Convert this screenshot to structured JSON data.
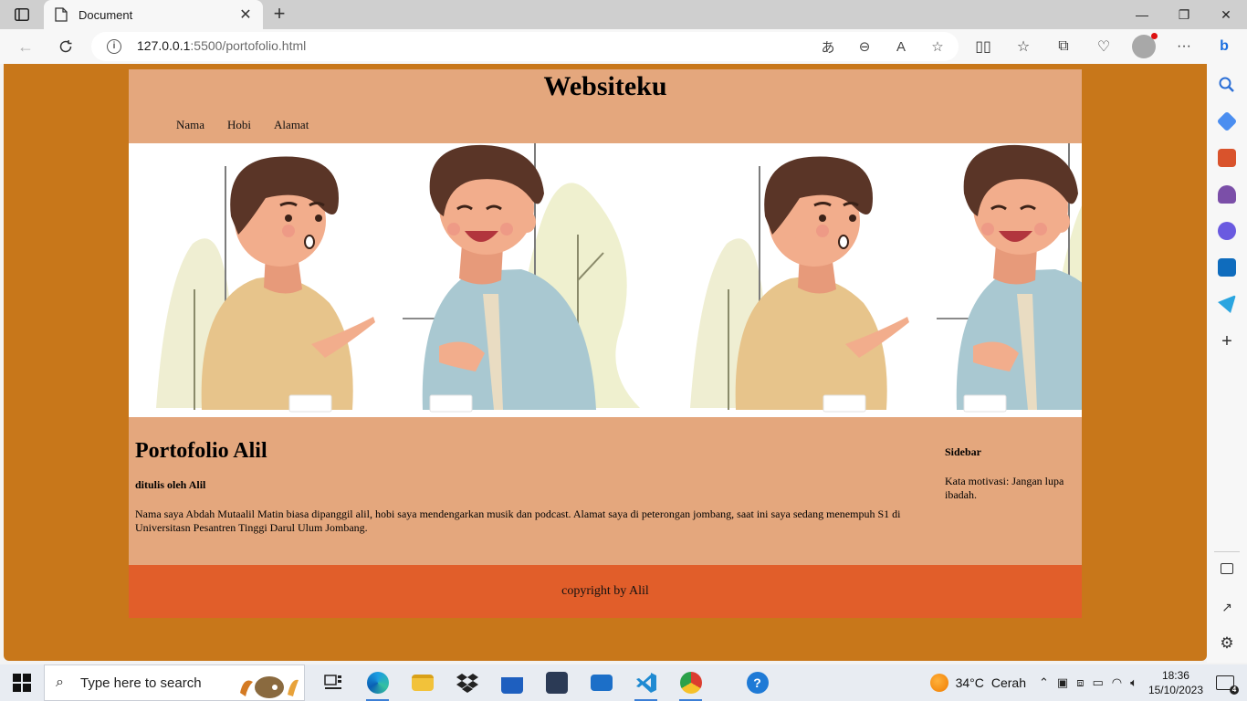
{
  "browser": {
    "tab_title": "Document",
    "url_host": "127.0.0.1",
    "url_path": ":5500/portofolio.html"
  },
  "website": {
    "title": "Websiteku",
    "nav": [
      "Nama",
      "Hobi",
      "Alamat"
    ],
    "hero_image": "two cartoon men talking illustration",
    "heading": "Portofolio Alil",
    "author": "ditulis oleh Alil",
    "body": "Nama saya Abdah Mutaalil Matin biasa dipanggil alil, hobi saya mendengarkan musik dan podcast. Alamat saya di peterongan jombang, saat ini saya sedang menempuh S1 di Universitasn Pesantren Tinggi Darul Ulum Jombang.",
    "sidebar_title": "Sidebar",
    "sidebar_text": "Kata motivasi: Jangan lupa ibadah.",
    "footer": "copyright by Alil",
    "colors": {
      "background": "#c8771a",
      "header": "#e4a77d",
      "footer": "#e15e2a"
    }
  },
  "taskbar": {
    "search_placeholder": "Type here to search",
    "weather_temp": "34°C",
    "weather_text": "Cerah",
    "time": "18:36",
    "date": "15/10/2023",
    "notification_count": "4"
  }
}
